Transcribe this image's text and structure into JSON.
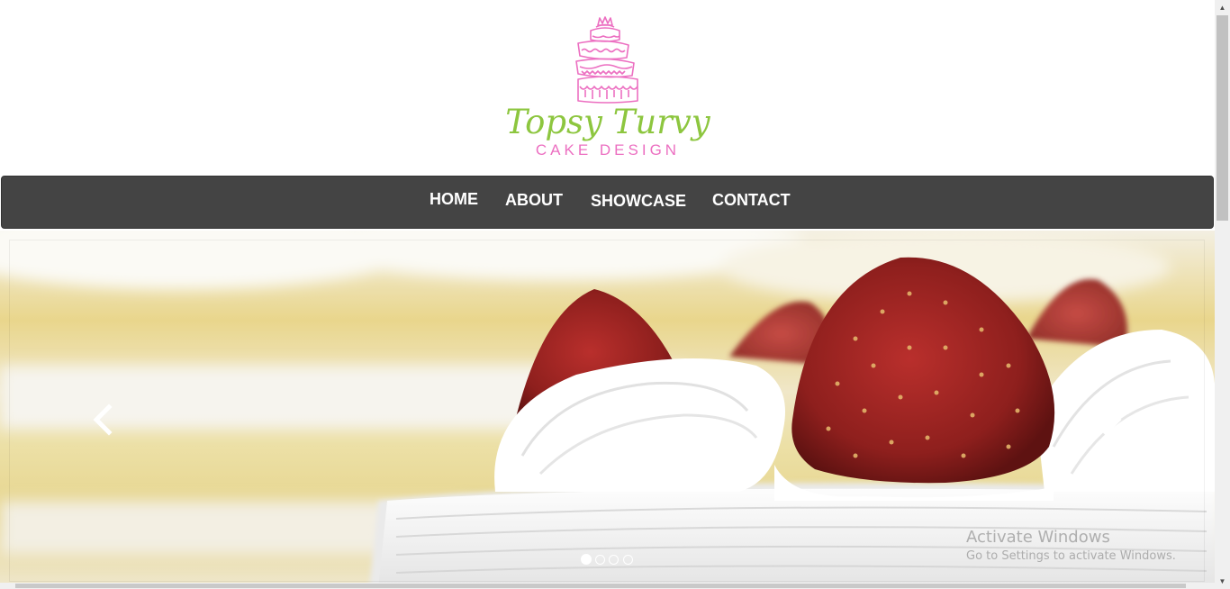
{
  "brand": {
    "title": "Topsy Turvy",
    "subtitle": "CAKE DESIGN",
    "logo_icon": "tiered-cake-icon",
    "colors": {
      "title": "#8dc63f",
      "subtitle": "#ec6fc1",
      "icon": "#ec6fc1"
    }
  },
  "nav": {
    "items": [
      {
        "label": "HOME"
      },
      {
        "label": "ABOUT"
      },
      {
        "label": "SHOWCASE"
      },
      {
        "label": "CONTACT"
      }
    ],
    "background": "#444444"
  },
  "carousel": {
    "image_alt": "Strawberry shortcake with whipped cream",
    "prev_icon": "chevron-left-icon",
    "next_icon": "chevron-right-icon",
    "slide_count": 4,
    "active_slide": 1
  },
  "watermark": {
    "title": "Activate Windows",
    "subtitle": "Go to Settings to activate Windows."
  }
}
